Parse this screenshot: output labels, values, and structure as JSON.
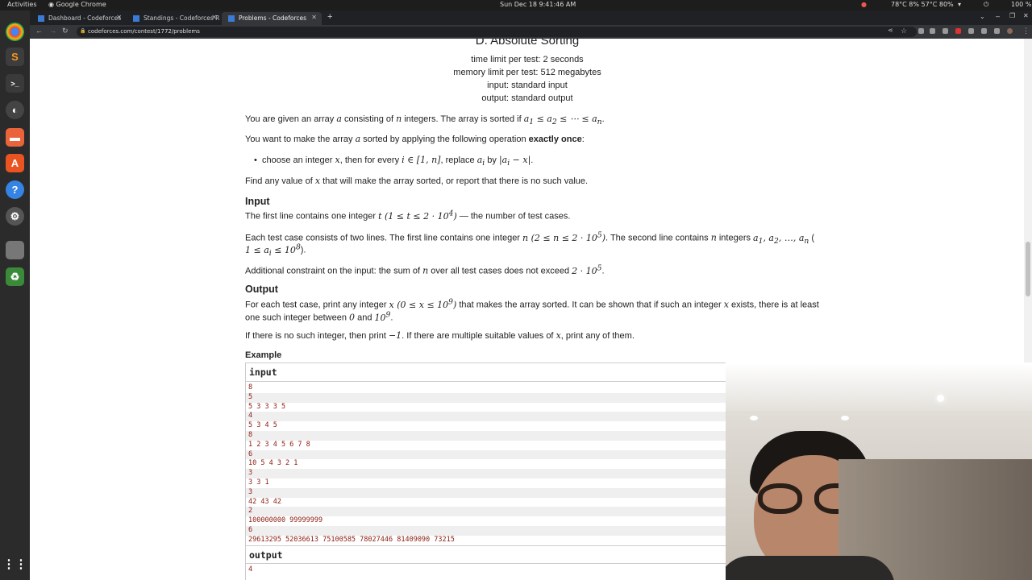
{
  "system_bar": {
    "activities": "Activities",
    "app": "Google Chrome",
    "clock": "Sun Dec 18  9:41:46 AM",
    "stats": "78°C 8% 57°C 80%",
    "battery": "100 %"
  },
  "tabs": [
    {
      "label": "Dashboard - Codeforces",
      "active": false
    },
    {
      "label": "Standings - Codeforces R",
      "active": false
    },
    {
      "label": "Problems - Codeforces",
      "active": true
    }
  ],
  "address_bar": {
    "url": "codeforces.com/contest/1772/problems"
  },
  "problem": {
    "title": "D. Absolute Sorting",
    "time_limit": "time limit per test: 2 seconds",
    "memory_limit": "memory limit per test: 512 megabytes",
    "input_file": "input: standard input",
    "output_file": "output: standard output",
    "statement": {
      "p1a": "You are given an array ",
      "p1b": " consisting of ",
      "p1c": " integers. The array is sorted if ",
      "p2a": "You want to make the array ",
      "p2b": " sorted by applying the following operation ",
      "p2bold": "exactly once",
      "bullet_a": "choose an integer ",
      "bullet_b": ", then for every ",
      "bullet_c": ", replace ",
      "bullet_d": " by ",
      "p3a": "Find any value of ",
      "p3b": " that will make the array sorted, or report that there is no such value."
    },
    "input_section": {
      "heading": "Input",
      "l1a": "The first line contains one integer ",
      "l1b": " — the number of test cases.",
      "l2a": "Each test case consists of two lines. The first line contains one integer ",
      "l2b": ". The second line contains ",
      "l2c": " integers ",
      "l3a": "Additional constraint on the input: the sum of ",
      "l3b": " over all test cases does not exceed "
    },
    "output_section": {
      "heading": "Output",
      "l1a": "For each test case, print any integer ",
      "l1b": " that makes the array sorted. It can be shown that if such an integer ",
      "l1c": " exists, there is at least",
      "l2a": "one such integer between ",
      "l2b": " and ",
      "l3a": "If there is no such integer, then print ",
      "l3b": ". If there are multiple suitable values of ",
      "l3c": ", print any of them."
    },
    "example": {
      "heading": "Example",
      "input_label": "input",
      "input_lines": [
        "8",
        "5",
        "5 3 3 3 5",
        "4",
        "5 3 4 5",
        "8",
        "1 2 3 4 5 6 7 8",
        "6",
        "10 5 4 3 2 1",
        "3",
        "3 3 1",
        "3",
        "42 43 42",
        "2",
        "100000000 99999999",
        "6",
        "29613295 52036613 75100585 78027446 81409090 73215"
      ],
      "output_label": "output",
      "output_lines": [
        "4"
      ]
    }
  }
}
